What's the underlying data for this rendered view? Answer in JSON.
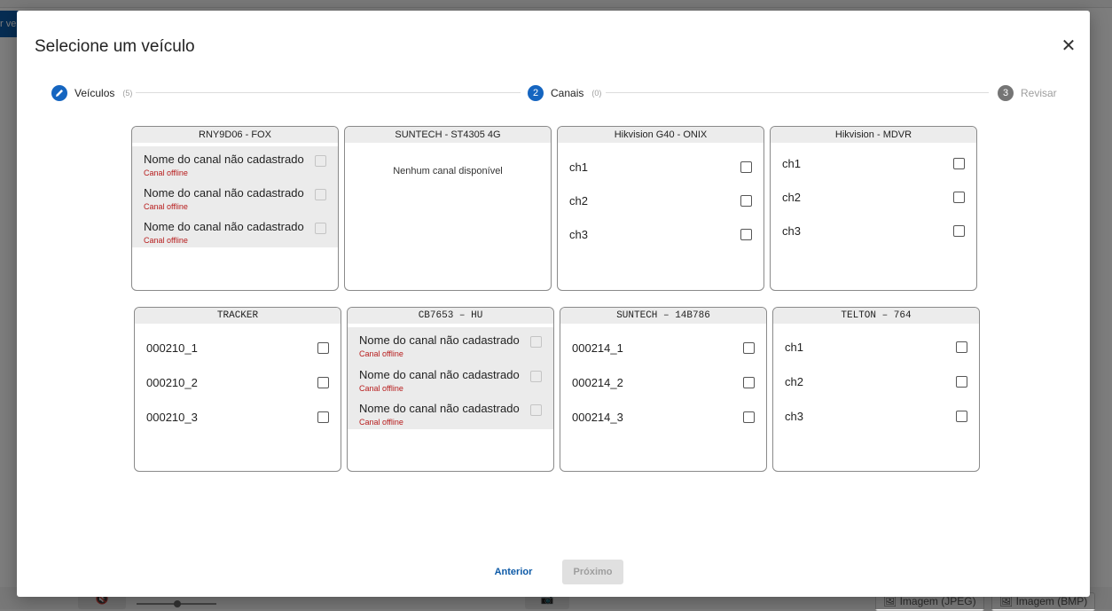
{
  "background": {
    "top_button_text": "r vei",
    "mute_icon": "speaker-mute-icon",
    "camera_icon": "camera-off-icon",
    "btn_jpeg": "🖼 Imagem (JPEG)",
    "btn_bmp": "🖼 Imagem (BMP)"
  },
  "modal": {
    "title": "Selecione um veículo",
    "close_label": "✕"
  },
  "stepper": {
    "steps": [
      {
        "number": "✎",
        "label": "Veículos",
        "count": "(5)",
        "state": "done"
      },
      {
        "number": "2",
        "label": "Canais",
        "count": "(0)",
        "state": "active"
      },
      {
        "number": "3",
        "label": "Revisar",
        "count": "",
        "state": "inactive"
      }
    ]
  },
  "cards": [
    {
      "title": "RNY9D06 - FOX",
      "channels": [
        {
          "name": "Nome do canal não cadastrado",
          "status": "Canal offline"
        },
        {
          "name": "Nome do canal não cadastrado",
          "status": "Canal offline"
        },
        {
          "name": "Nome do canal não cadastrado",
          "status": "Canal offline"
        }
      ]
    },
    {
      "title": "SUNTECH - ST4305 4G",
      "empty_message": "Nenhum canal disponível"
    },
    {
      "title": "Hikvision G40 - ONIX",
      "channels": [
        {
          "name": "ch1"
        },
        {
          "name": "ch2"
        },
        {
          "name": "ch3"
        }
      ]
    },
    {
      "title": "Hikvision - MDVR",
      "channels": [
        {
          "name": "ch1"
        },
        {
          "name": "ch2"
        },
        {
          "name": "ch3"
        }
      ]
    },
    {
      "title": "TRACKER",
      "channels": [
        {
          "name": "000210_1"
        },
        {
          "name": "000210_2"
        },
        {
          "name": "000210_3"
        }
      ]
    },
    {
      "title": "CB7653 – HU",
      "channels": [
        {
          "name": "Nome do canal não cadastrado",
          "status": "Canal offline"
        },
        {
          "name": "Nome do canal não cadastrado",
          "status": "Canal offline"
        },
        {
          "name": "Nome do canal não cadastrado",
          "status": "Canal offline"
        }
      ]
    },
    {
      "title": "SUNTECH – 14B786",
      "channels": [
        {
          "name": "000214_1"
        },
        {
          "name": "000214_2"
        },
        {
          "name": "000214_3"
        }
      ]
    },
    {
      "title": "TELTON – 764",
      "channels": [
        {
          "name": "ch1"
        },
        {
          "name": "ch2"
        },
        {
          "name": "ch3"
        }
      ]
    }
  ],
  "footer": {
    "prev_label": "Anterior",
    "next_label": "Próximo"
  }
}
